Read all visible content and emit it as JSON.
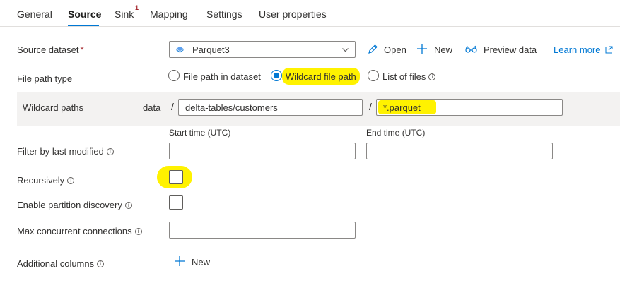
{
  "tabs": [
    {
      "label": "General"
    },
    {
      "label": "Source"
    },
    {
      "label": "Sink",
      "badge": "1"
    },
    {
      "label": "Mapping"
    },
    {
      "label": "Settings"
    },
    {
      "label": "User properties"
    }
  ],
  "source_dataset": {
    "label": "Source dataset",
    "required_mark": "*",
    "selected_value": "Parquet3",
    "icon": "parquet-dataset-icon"
  },
  "actions": {
    "open_label": "Open",
    "new_label": "New",
    "preview_label": "Preview data",
    "learn_more_label": "Learn more"
  },
  "file_path_type": {
    "label": "File path type",
    "options": [
      {
        "label": "File path in dataset",
        "checked": false
      },
      {
        "label": "Wildcard file path",
        "checked": true
      },
      {
        "label": "List of files",
        "checked": false
      }
    ]
  },
  "wildcard": {
    "label": "Wildcard paths",
    "container": "data",
    "separator": "/",
    "folder_path": "delta-tables/customers",
    "file_name": "*.parquet"
  },
  "filter_last_modified": {
    "label": "Filter by last modified",
    "start_label": "Start time (UTC)",
    "end_label": "End time (UTC)",
    "start_value": "",
    "end_value": ""
  },
  "recursively": {
    "label": "Recursively",
    "checked": false
  },
  "partition_discovery": {
    "label": "Enable partition discovery",
    "checked": false
  },
  "max_connections": {
    "label": "Max concurrent connections",
    "value": ""
  },
  "additional_columns": {
    "label": "Additional columns",
    "new_label": "New"
  },
  "colors": {
    "accent": "#0078d4",
    "highlight": "#fff200",
    "required": "#a4262c",
    "band": "#f3f2f1"
  }
}
